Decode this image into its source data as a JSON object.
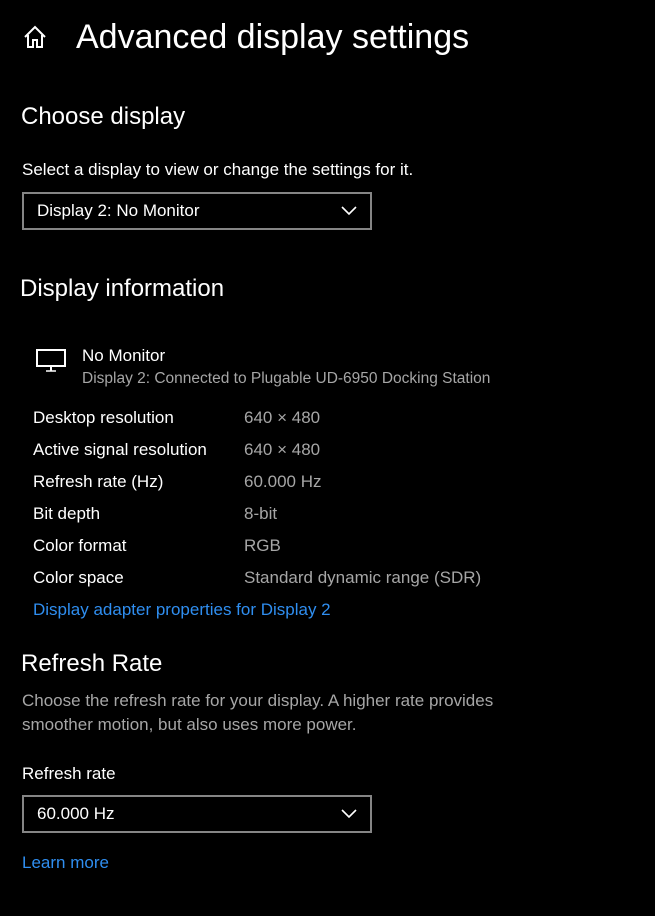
{
  "header": {
    "title": "Advanced display settings",
    "home_icon": "home-icon"
  },
  "choose_display": {
    "heading": "Choose display",
    "description": "Select a display to view or change the settings for it.",
    "selected": "Display 2: No Monitor"
  },
  "display_info": {
    "heading": "Display information",
    "monitor_icon": "monitor-icon",
    "monitor_name": "No Monitor",
    "monitor_detail": "Display 2: Connected to Plugable UD-6950 Docking Station",
    "rows": [
      {
        "label": "Desktop resolution",
        "value": "640 × 480"
      },
      {
        "label": "Active signal resolution",
        "value": "640 × 480"
      },
      {
        "label": "Refresh rate (Hz)",
        "value": "60.000 Hz"
      },
      {
        "label": "Bit depth",
        "value": "8-bit"
      },
      {
        "label": "Color format",
        "value": "RGB"
      },
      {
        "label": "Color space",
        "value": "Standard dynamic range (SDR)"
      }
    ],
    "adapter_link": "Display adapter properties for Display 2"
  },
  "refresh_rate": {
    "heading": "Refresh Rate",
    "description_line1": "Choose the refresh rate for your display. A higher rate provides",
    "description_line2": "smoother motion, but also uses more power.",
    "field_label": "Refresh rate",
    "selected": "60.000 Hz",
    "learn_more": "Learn more"
  },
  "colors": {
    "background": "#000000",
    "text": "#ffffff",
    "muted_text": "#a6a6a6",
    "link": "#2f8ef0",
    "dropdown_border": "#858585"
  }
}
